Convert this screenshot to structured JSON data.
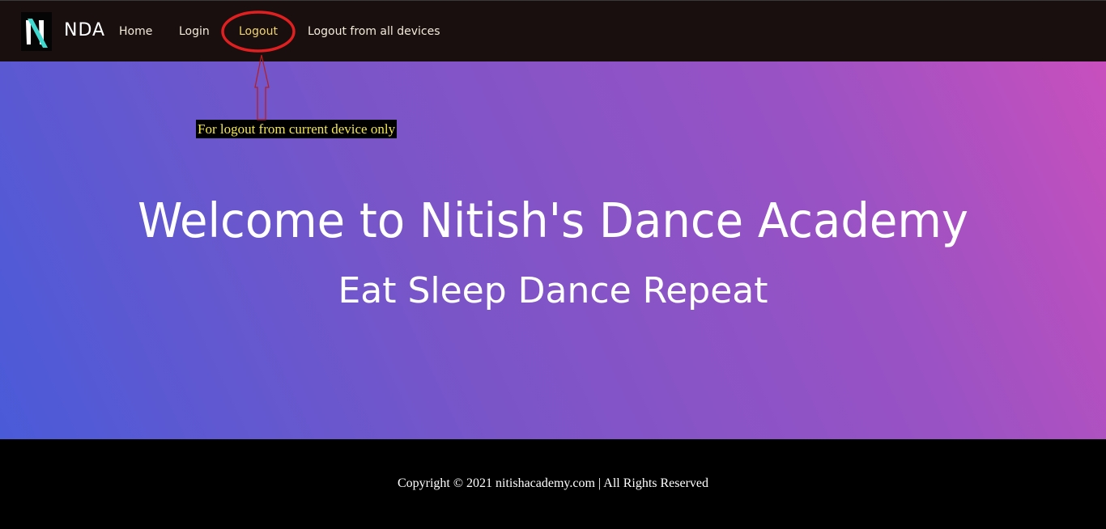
{
  "header": {
    "brand": "NDA",
    "nav": [
      {
        "label": "Home"
      },
      {
        "label": "Login"
      },
      {
        "label": "Logout"
      },
      {
        "label": "Logout from all devices"
      }
    ]
  },
  "hero": {
    "title": "Welcome to Nitish's Dance Academy",
    "subtitle": "Eat Sleep Dance Repeat"
  },
  "annotation": {
    "note": "For logout from current device only",
    "highlight_color": "#e02020",
    "note_text_color": "#f5e94a"
  },
  "footer": {
    "copyright": "Copyright © 2021 nitishacademy.com | All Rights Reserved"
  },
  "colors": {
    "navbar": "#1a0f0f",
    "active_link": "#f0d46e",
    "gradient_start": "#4a5bd8",
    "gradient_end": "#c84fbd",
    "logo_accent": "#40d9d0"
  }
}
